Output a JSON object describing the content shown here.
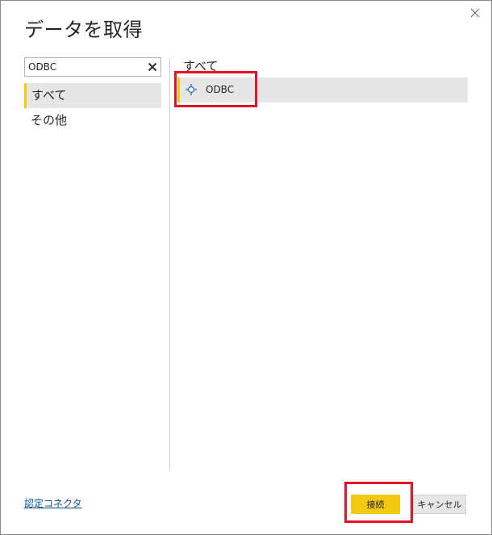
{
  "dialog": {
    "title": "データを取得",
    "close_icon": "close-icon"
  },
  "search": {
    "value": "ODBC",
    "clear_icon": "clear-icon"
  },
  "categories": [
    {
      "label": "すべて",
      "selected": true
    },
    {
      "label": "その他",
      "selected": false
    }
  ],
  "results": {
    "heading": "すべて",
    "items": [
      {
        "label": "ODBC",
        "icon": "odbc-connector-icon",
        "selected": true
      }
    ]
  },
  "footer": {
    "certified_link": "認定コネクタ",
    "connect_label": "接続",
    "cancel_label": "キャンセル"
  },
  "colors": {
    "accent": "#f2c811",
    "highlight": "#e81123",
    "selected_bg": "#e6e6e6",
    "link": "#0b5394",
    "icon_blue": "#3b7cc4"
  }
}
